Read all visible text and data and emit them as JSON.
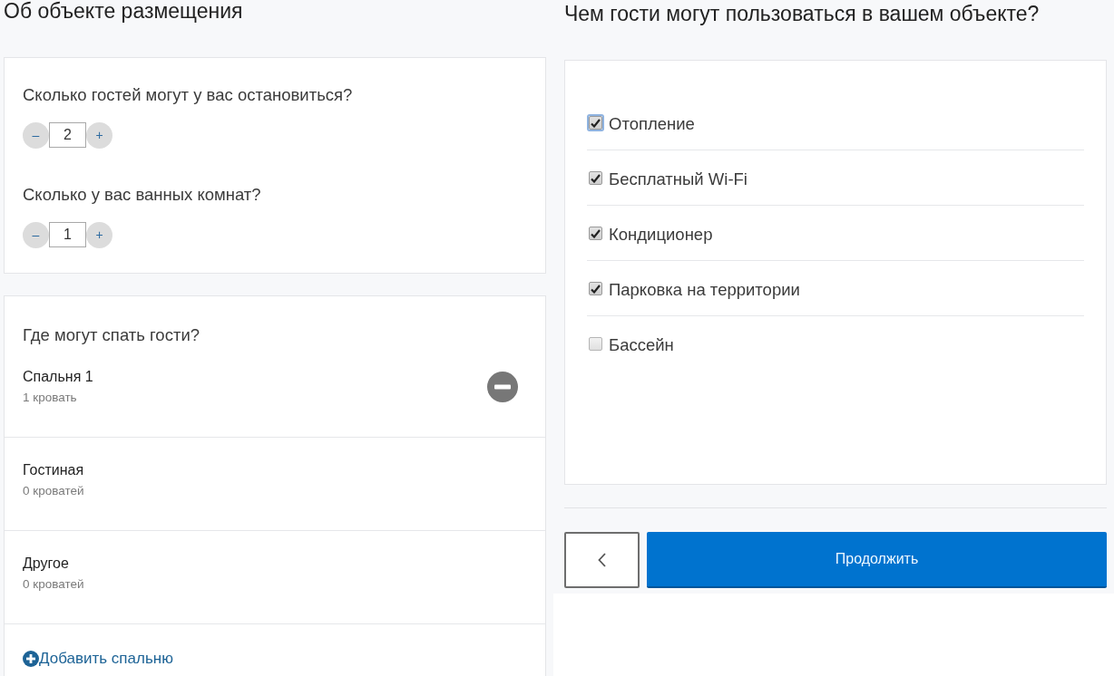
{
  "left_heading": "Об объекте размещения",
  "capacity": {
    "steppers": [
      {
        "question": "Сколько гостей могут у вас остановиться?",
        "decrement": "–",
        "value": "2",
        "increment": "+"
      },
      {
        "question": "Сколько у вас ванных комнат?",
        "decrement": "–",
        "value": "1",
        "increment": "+"
      }
    ]
  },
  "sleeping": {
    "title": "Где могут спать гости?",
    "rooms": [
      {
        "name": "Спальня 1",
        "beds": "1 кровать",
        "removable": true
      },
      {
        "name": "Гостиная",
        "beds": "0 кроватей",
        "removable": false
      },
      {
        "name": "Другое",
        "beds": "0 кроватей",
        "removable": false
      }
    ],
    "add_link": "Добавить спальню"
  },
  "right_heading": "Чем гости могут пользоваться в вашем объекте?",
  "amenities": [
    {
      "label": "Отопление",
      "checked": true,
      "focused": true
    },
    {
      "label": "Бесплатный Wi-Fi",
      "checked": true,
      "focused": false
    },
    {
      "label": "Кондиционер",
      "checked": true,
      "focused": false
    },
    {
      "label": "Парковка на территории",
      "checked": true,
      "focused": false
    },
    {
      "label": "Бассейн",
      "checked": false,
      "focused": false
    }
  ],
  "actions": {
    "continue": "Продолжить"
  }
}
